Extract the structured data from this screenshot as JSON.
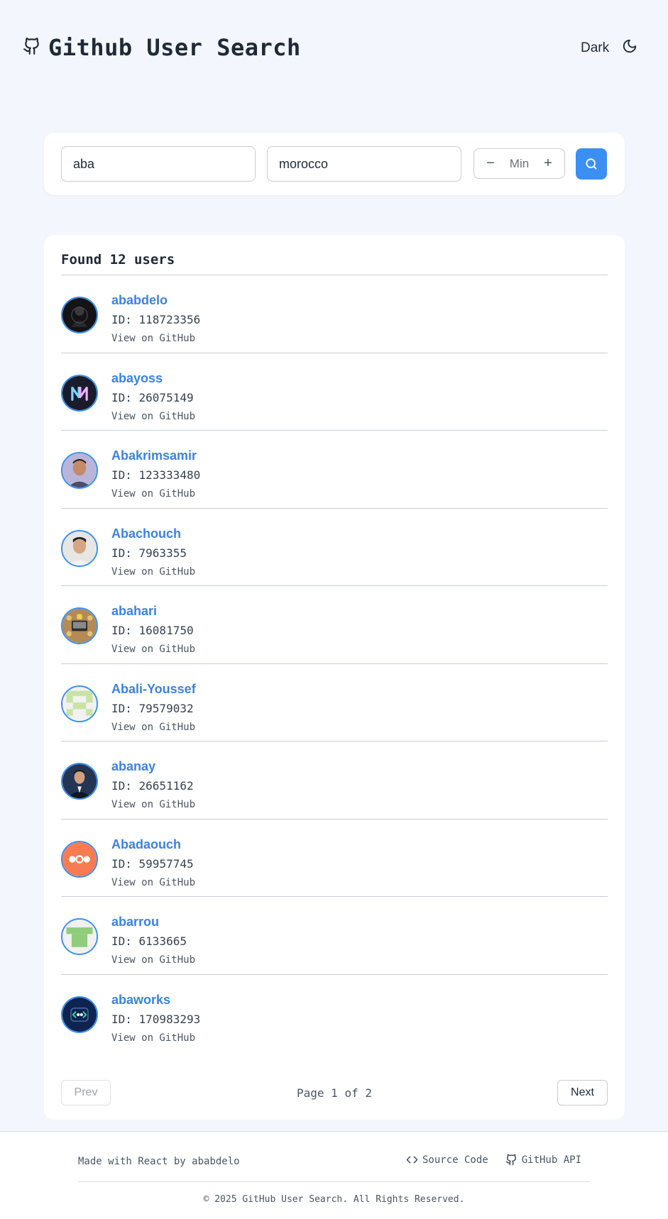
{
  "header": {
    "title": "Github User Search",
    "theme_label": "Dark",
    "brand_icon": "github-icon",
    "theme_icon": "moon-icon"
  },
  "search": {
    "username_value": "aba",
    "location_value": "morocco",
    "repos_label": "Min",
    "decrement_glyph": "−",
    "increment_glyph": "+",
    "search_icon": "search-icon",
    "accent": "#3b8ff3"
  },
  "results": {
    "found_text": "Found 12 users",
    "users": [
      {
        "login": "ababdelo",
        "id_text": "ID: 118723356",
        "link": "View on GitHub"
      },
      {
        "login": "abayoss",
        "id_text": "ID: 26075149",
        "link": "View on GitHub"
      },
      {
        "login": "Abakrimsamir",
        "id_text": "ID: 123333480",
        "link": "View on GitHub"
      },
      {
        "login": "Abachouch",
        "id_text": "ID: 7963355",
        "link": "View on GitHub"
      },
      {
        "login": "abahari",
        "id_text": "ID: 16081750",
        "link": "View on GitHub"
      },
      {
        "login": "Abali-Youssef",
        "id_text": "ID: 79579032",
        "link": "View on GitHub"
      },
      {
        "login": "abanay",
        "id_text": "ID: 26651162",
        "link": "View on GitHub"
      },
      {
        "login": "Abadaouch",
        "id_text": "ID: 59957745",
        "link": "View on GitHub"
      },
      {
        "login": "abarrou",
        "id_text": "ID: 6133665",
        "link": "View on GitHub"
      },
      {
        "login": "abaworks",
        "id_text": "ID: 170983293",
        "link": "View on GitHub"
      }
    ],
    "pagination": {
      "prev_label": "Prev",
      "next_label": "Next",
      "page_text": "Page 1 of 2"
    }
  },
  "footer": {
    "made_with": "Made with React by",
    "author": "ababdelo",
    "source_label": "Source Code",
    "api_label": "GitHub API",
    "copyright": "© 2025 GitHub User Search. All Rights Reserved."
  }
}
